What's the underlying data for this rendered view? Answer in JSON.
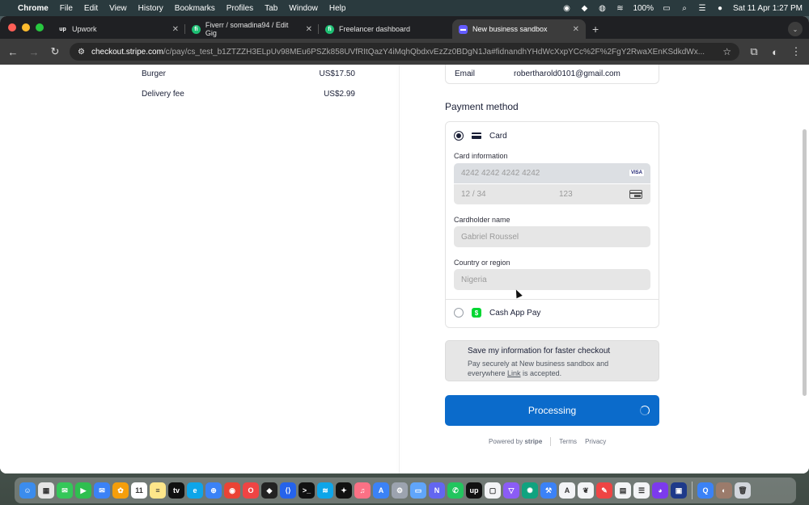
{
  "menubar": {
    "app": "Chrome",
    "items": [
      "File",
      "Edit",
      "View",
      "History",
      "Bookmarks",
      "Profiles",
      "Tab",
      "Window",
      "Help"
    ],
    "battery": "100%",
    "datetime": "Sat 11 Apr  1:27 PM"
  },
  "tabs": [
    {
      "title": "Upwork",
      "favicon": "up",
      "color": "#1f2023"
    },
    {
      "title": "Fiverr / somadina94 / Edit Gig",
      "favicon": "fi",
      "color": "#1dbf73"
    },
    {
      "title": "Freelancer dashboard",
      "favicon": "fi",
      "color": "#1dbf73"
    },
    {
      "title": "New business sandbox",
      "favicon": "■",
      "color": "#635bff"
    }
  ],
  "omnibox": {
    "host": "checkout.stripe.com",
    "path": "/c/pay/cs_test_b1ZTZZH3ELpUv98MEu6PSZk858UVfRItQazY4iMqhQbdxvEzZz0BDgN1Ja#fidnandhYHdWcXxpYCc%2F%2FgY2RwaXEnKSdkdWx..."
  },
  "order": {
    "lines": [
      {
        "label": "Burger",
        "amount": "US$17.50"
      },
      {
        "label": "Delivery fee",
        "amount": "US$2.99"
      }
    ]
  },
  "contact": {
    "email_label": "Email",
    "email_value": "robertharold0101@gmail.com"
  },
  "payment": {
    "title": "Payment method",
    "card_label": "Card",
    "card_info_label": "Card information",
    "card_number": "4242 4242 4242 4242",
    "card_brand": "VISA",
    "expiry": "12 / 34",
    "cvc": "123",
    "cardholder_label": "Cardholder name",
    "cardholder_value": "Gabriel Roussel",
    "country_label": "Country or region",
    "country_value": "Nigeria",
    "cashapp_label": "Cash App Pay",
    "cashapp_icon": "$"
  },
  "link": {
    "title": "Save my information for faster checkout",
    "text_before": "Pay securely at New business sandbox and everywhere ",
    "link_word": "Link",
    "text_after": " is accepted."
  },
  "pay_button": {
    "label": "Processing"
  },
  "footer": {
    "powered_by": "Powered by",
    "brand": "stripe",
    "terms": "Terms",
    "privacy": "Privacy"
  },
  "colors": {
    "accent": "#0b6bcb",
    "cashapp": "#00d632"
  },
  "dock_apps": [
    {
      "name": "finder-icon",
      "color": "#3b8ced",
      "glyph": "☺"
    },
    {
      "name": "launchpad-icon",
      "color": "#e5e5e5",
      "glyph": "▦"
    },
    {
      "name": "messages-icon",
      "color": "#34c759",
      "glyph": "✉"
    },
    {
      "name": "facetime-icon",
      "color": "#2fbf4f",
      "glyph": "▶"
    },
    {
      "name": "mail-icon",
      "color": "#3b82f6",
      "glyph": "✉"
    },
    {
      "name": "photos-icon",
      "color": "#f59e0b",
      "glyph": "✿"
    },
    {
      "name": "calendar-icon",
      "color": "#ffffff",
      "glyph": "11"
    },
    {
      "name": "notes-icon",
      "color": "#fde68a",
      "glyph": "≡"
    },
    {
      "name": "tv-icon",
      "color": "#111111",
      "glyph": "tv"
    },
    {
      "name": "edge-icon",
      "color": "#0ea5e9",
      "glyph": "e"
    },
    {
      "name": "safari-icon",
      "color": "#3b82f6",
      "glyph": "⊕"
    },
    {
      "name": "chrome-icon",
      "color": "#ea4335",
      "glyph": "◉"
    },
    {
      "name": "opera-icon",
      "color": "#ef4444",
      "glyph": "O"
    },
    {
      "name": "cube-icon",
      "color": "#222222",
      "glyph": "◆"
    },
    {
      "name": "vscode-icon",
      "color": "#2563eb",
      "glyph": "⟨⟩"
    },
    {
      "name": "terminal-icon",
      "color": "#111111",
      "glyph": ">_"
    },
    {
      "name": "docker-icon",
      "color": "#0ea5e9",
      "glyph": "≋"
    },
    {
      "name": "figma-icon",
      "color": "#111111",
      "glyph": "✦"
    },
    {
      "name": "music-icon",
      "color": "#fb7185",
      "glyph": "♫"
    },
    {
      "name": "appstore-icon",
      "color": "#3b82f6",
      "glyph": "A"
    },
    {
      "name": "settings-icon",
      "color": "#9ca3af",
      "glyph": "⚙"
    },
    {
      "name": "files-icon",
      "color": "#60a5fa",
      "glyph": "▭"
    },
    {
      "name": "notion-icon",
      "color": "#6366f1",
      "glyph": "N"
    },
    {
      "name": "whatsapp-icon",
      "color": "#22c55e",
      "glyph": "✆"
    },
    {
      "name": "upwork-icon",
      "color": "#111111",
      "glyph": "up"
    },
    {
      "name": "preview-icon",
      "color": "#f3f4f6",
      "glyph": "▢"
    },
    {
      "name": "proton-icon",
      "color": "#8b5cf6",
      "glyph": "▽"
    },
    {
      "name": "chatgpt-icon",
      "color": "#10a37f",
      "glyph": "✺"
    },
    {
      "name": "xcode-icon",
      "color": "#3b82f6",
      "glyph": "⚒"
    },
    {
      "name": "fontbook-icon",
      "color": "#f3f4f6",
      "glyph": "A"
    },
    {
      "name": "mongodb-icon",
      "color": "#f3f4f6",
      "glyph": "❦"
    },
    {
      "name": "pen-icon",
      "color": "#ef4444",
      "glyph": "✎"
    },
    {
      "name": "calculator-icon",
      "color": "#f3f4f6",
      "glyph": "▤"
    },
    {
      "name": "reminders-icon",
      "color": "#f3f4f6",
      "glyph": "☰"
    },
    {
      "name": "firefox-icon",
      "color": "#7c3aed",
      "glyph": "◕"
    },
    {
      "name": "finder2-icon",
      "color": "#1e3a8a",
      "glyph": "▣"
    },
    {
      "name": "quicktime-icon",
      "color": "#3b82f6",
      "glyph": "Q"
    },
    {
      "name": "photo-thumb-icon",
      "color": "#9b7b6b",
      "glyph": "◐"
    },
    {
      "name": "trash-icon",
      "color": "#d1d5db",
      "glyph": "🗑"
    }
  ]
}
